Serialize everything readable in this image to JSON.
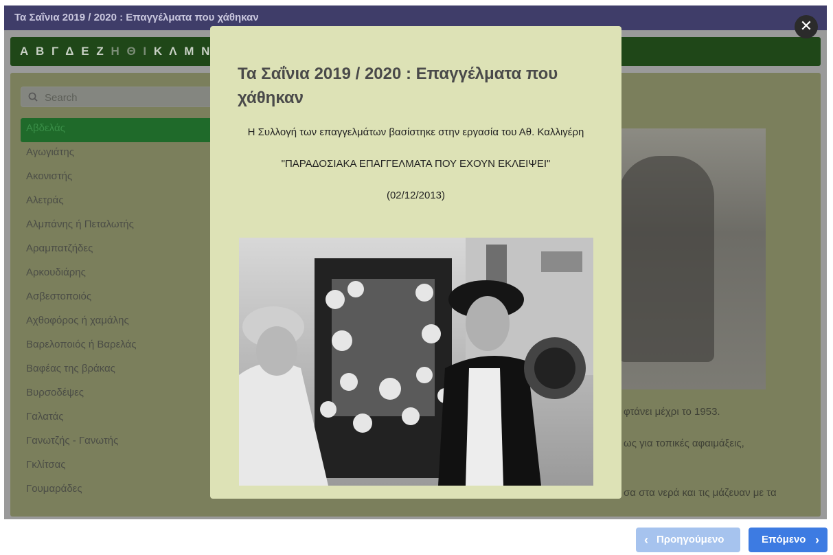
{
  "window": {
    "title": "Τα Σαΐνια 2019 / 2020 : Επαγγέλματα που χάθηκαν"
  },
  "alphabet": {
    "letters_a": "Α Β Γ Δ Ε Ζ",
    "letters_dim": "Η Θ Ι",
    "letters_b": "Κ Λ Μ Ν Ξ"
  },
  "search": {
    "placeholder": "Search"
  },
  "list": {
    "items": [
      "Αβδελάς",
      "Αγωγιάτης",
      "Ακονιστής",
      "Αλετράς",
      "Αλμπάνης ή Πεταλωτής",
      "Αραμπατζήδες",
      "Αρκουδιάρης",
      "Ασβεστοποιός",
      "Αχθοφόρος ή χαμάλης",
      "Βαρελοποιός ή Βαρελάς",
      "Βαφέας της βράκας",
      "Βυρσοδέψες",
      "Γαλατάς",
      "Γανωτζής - Γανωτής",
      "Γκλίτσας",
      "Γουμαράδες"
    ]
  },
  "background_text": {
    "line1": "φτάνει μέχρι το 1953.",
    "line2": "ως     για     τοπικές αφαιμάξεις,",
    "line3": "σα στα νερά και τις μάζευαν με τα"
  },
  "modal": {
    "title": "Τα Σαΐνια 2019 / 2020 : Επαγγέλματα που χάθηκαν",
    "para1": "Η Συλλογή των επαγγελμάτων βασίστηκε στην εργασία του Αθ. Καλλιγέρη",
    "para2": "\"ΠΑΡΑΔΟΣΙΑΚΑ ΕΠΑΓΓΕΛΜΑΤΑ ΠΟΥ ΕΧΟΥΝ ΕΚΛΕΙΨΕΙ\"",
    "para3": "(02/12/2013)",
    "close_symbol": "✕"
  },
  "nav": {
    "prev_label": "Προηγούμενο",
    "next_label": "Επόμενο"
  },
  "icons": {
    "search": "search-icon",
    "close": "close-icon",
    "prev": "chevron-left-icon",
    "next": "chevron-right-icon"
  },
  "colors": {
    "titlebar": "#3f3d69",
    "alphabar": "#1f4718",
    "modal_bg": "#dde2b6",
    "next_button": "#3d7be2",
    "prev_button": "#a6c3ee",
    "active_item": "#1f6a2a"
  }
}
